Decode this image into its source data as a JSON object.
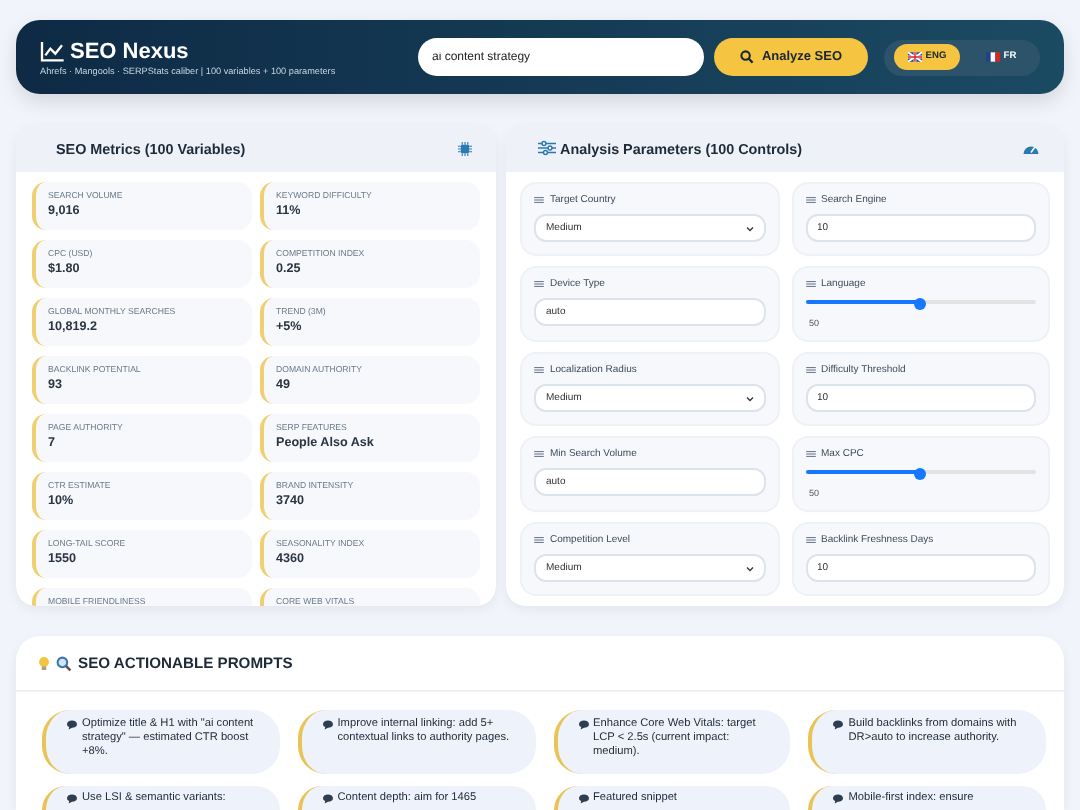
{
  "header": {
    "title": "SEO Nexus",
    "subtitle": "Ahrefs · Mangools · SERPStats caliber | 100 variables + 100 parameters",
    "search": {
      "value": "ai content strategy"
    },
    "analyze_button": "Analyze SEO",
    "languages": [
      {
        "code": "ENG",
        "selected": true
      },
      {
        "code": "FR",
        "selected": false
      }
    ]
  },
  "metrics_panel": {
    "title": "SEO Metrics (100 Variables)",
    "metrics": [
      {
        "label": "SEARCH VOLUME",
        "value": "9,016"
      },
      {
        "label": "KEYWORD DIFFICULTY",
        "value": "11%"
      },
      {
        "label": "CPC (USD)",
        "value": "$1.80"
      },
      {
        "label": "COMPETITION INDEX",
        "value": "0.25"
      },
      {
        "label": "GLOBAL MONTHLY SEARCHES",
        "value": "10,819.2"
      },
      {
        "label": "TREND (3M)",
        "value": "+5%"
      },
      {
        "label": "BACKLINK POTENTIAL",
        "value": "93"
      },
      {
        "label": "DOMAIN AUTHORITY",
        "value": "49"
      },
      {
        "label": "PAGE AUTHORITY",
        "value": "7"
      },
      {
        "label": "SERP FEATURES",
        "value": "People Also Ask"
      },
      {
        "label": "CTR ESTIMATE",
        "value": "10%"
      },
      {
        "label": "BRAND INTENSITY",
        "value": "3740"
      },
      {
        "label": "LONG-TAIL SCORE",
        "value": "1550"
      },
      {
        "label": "SEASONALITY INDEX",
        "value": "4360"
      },
      {
        "label": "MOBILE FRIENDLINESS"
      },
      {
        "label": "CORE WEB VITALS"
      }
    ]
  },
  "parameters_panel": {
    "title": "Analysis Parameters (100 Controls)",
    "parameters": [
      {
        "label": "Target Country",
        "kind": "select",
        "value": "Medium"
      },
      {
        "label": "Search Engine",
        "kind": "input",
        "value": "10"
      },
      {
        "label": "Device Type",
        "kind": "input",
        "value": "auto"
      },
      {
        "label": "Language",
        "kind": "slider",
        "level": 0.5,
        "reading": "50"
      },
      {
        "label": "Localization Radius",
        "kind": "select",
        "value": "Medium"
      },
      {
        "label": "Difficulty Threshold",
        "kind": "input",
        "value": "10"
      },
      {
        "label": "Min Search Volume",
        "kind": "input",
        "value": "auto"
      },
      {
        "label": "Max CPC",
        "kind": "slider",
        "level": 0.5,
        "reading": "50"
      },
      {
        "label": "Competition Level",
        "kind": "select",
        "value": "Medium"
      },
      {
        "label": "Backlink Freshness Days",
        "kind": "input",
        "value": "10"
      }
    ]
  },
  "prompts_panel": {
    "title": "SEO ACTIONABLE PROMPTS",
    "prompts": [
      "Optimize title & H1 with \"ai content strategy\" — estimated CTR boost +8%.",
      "Improve internal linking: add 5+ contextual links to authority pages.",
      "Enhance Core Web Vitals: target LCP < 2.5s (current impact: medium).",
      "Build backlinks from domains with DR>auto to increase authority.",
      "Use LSI & semantic variants:",
      "Content depth: aim for 1465",
      "Featured snippet",
      "Mobile-first index: ensure"
    ]
  }
}
